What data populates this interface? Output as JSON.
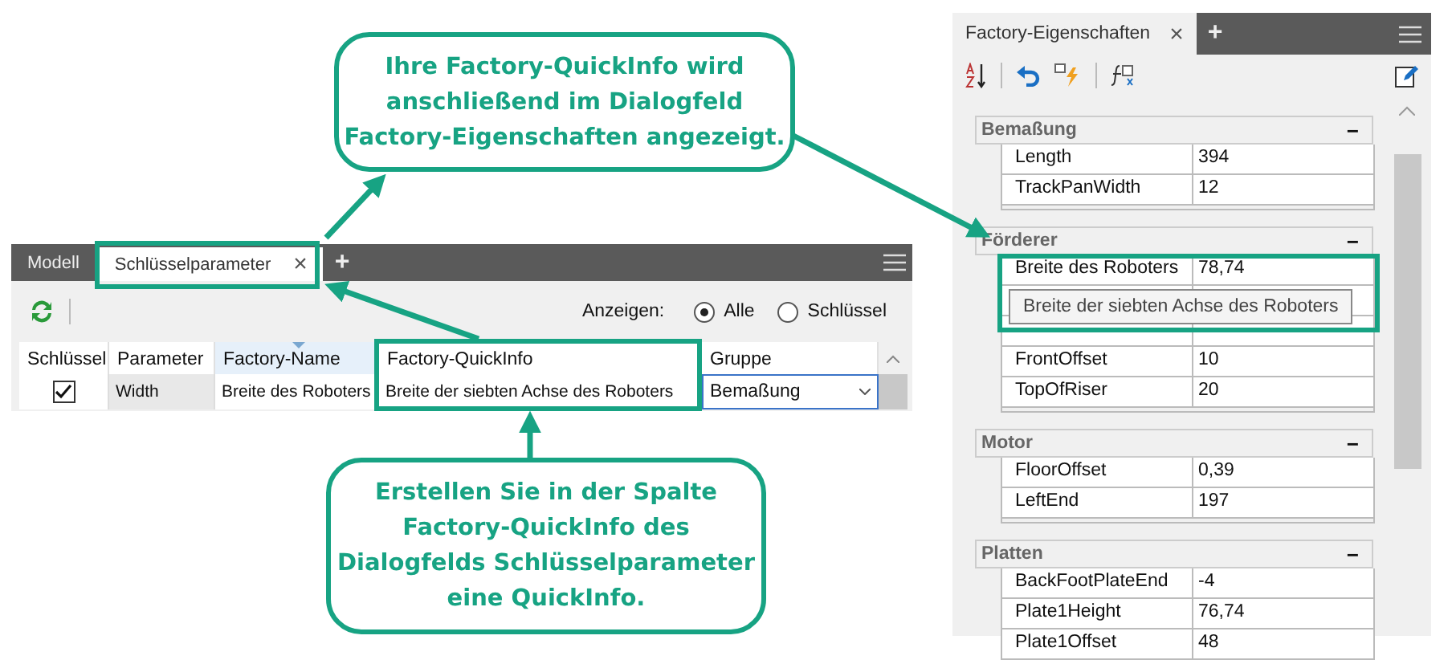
{
  "key_parameters_panel": {
    "tabs": [
      {
        "label": "Modell",
        "selected": false
      },
      {
        "label": "Schlüsselparameter",
        "selected": true,
        "close": "×"
      }
    ],
    "add_tab": "+",
    "show_label": "Anzeigen:",
    "show_options": [
      {
        "label": "Alle",
        "selected": true
      },
      {
        "label": "Schlüssel",
        "selected": false
      }
    ],
    "table": {
      "columns": [
        "Schlüssel",
        "Parameter",
        "Factory-Name",
        "Factory-QuickInfo",
        "Gruppe"
      ],
      "rows": [
        {
          "key": true,
          "parameter": "Width",
          "factory_name": "Breite des Roboters",
          "quickinfo": "Breite der siebten Achse des Roboters",
          "group": "Bemaßung"
        }
      ]
    }
  },
  "properties_panel": {
    "tabs": [
      {
        "label": "Factory-Eigenschaften",
        "close": "×"
      }
    ],
    "add_tab": "+",
    "groups": [
      {
        "title": "Bemaßung",
        "toggle": "−",
        "rows": [
          {
            "name": "Length",
            "value": "394"
          },
          {
            "name": "TrackPanWidth",
            "value": "12"
          }
        ]
      },
      {
        "title": "Förderer",
        "toggle": "−",
        "highlighted": true,
        "tooltip": "Breite der siebten Achse des Roboters",
        "rows": [
          {
            "name": "Breite des Roboters",
            "value": "78,74"
          },
          {
            "covered": true
          },
          {
            "covered": true
          },
          {
            "name": "FrontOffset",
            "value": "10"
          },
          {
            "name": "TopOfRiser",
            "value": "20"
          }
        ]
      },
      {
        "title": "Motor",
        "toggle": "−",
        "rows": [
          {
            "name": "FloorOffset",
            "value": "0,39"
          },
          {
            "name": "LeftEnd",
            "value": "197"
          }
        ]
      },
      {
        "title": "Platten",
        "toggle": "−",
        "rows": [
          {
            "name": "BackFootPlateEnd",
            "value": "-4"
          },
          {
            "name": "Plate1Height",
            "value": "76,74"
          },
          {
            "name": "Plate1Offset",
            "value": "48"
          }
        ]
      }
    ]
  },
  "callouts": [
    {
      "lines": [
        "Ihre Factory-QuickInfo wird",
        "anschließend im Dialogfeld",
        "Factory-Eigenschaften angezeigt."
      ]
    },
    {
      "lines": [
        "Erstellen Sie in der Spalte",
        "Factory-QuickInfo des",
        "Dialogfelds Schlüsselparameter",
        "eine QuickInfo."
      ]
    }
  ]
}
